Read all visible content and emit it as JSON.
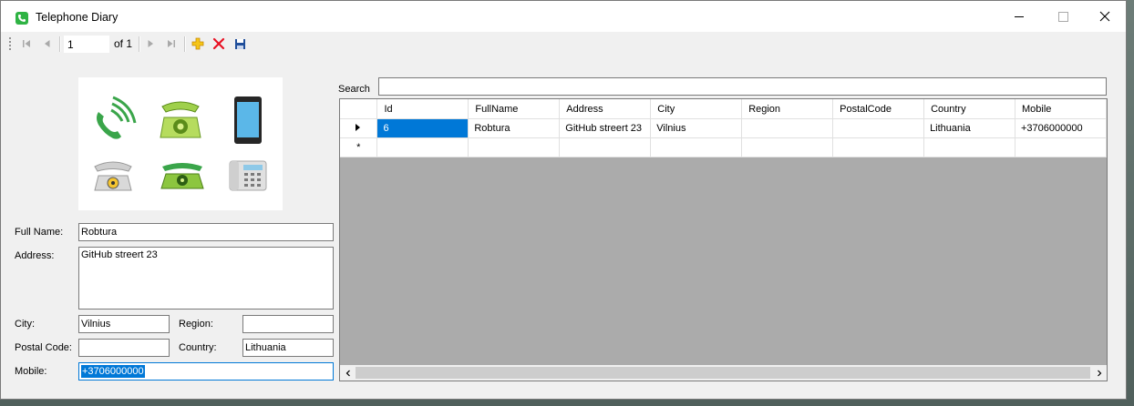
{
  "window": {
    "title": "Telephone Diary"
  },
  "navigator": {
    "position": "1",
    "count_label": "of 1"
  },
  "icons": {
    "app": "phone-icon",
    "first": "move-first-icon",
    "previous": "move-previous-icon",
    "next": "move-next-icon",
    "last": "move-last-icon",
    "add": "add-icon",
    "delete": "delete-icon",
    "save": "save-icon"
  },
  "colors": {
    "app_icon": "#2fb344",
    "add": "#e0a800",
    "delete": "#e81123",
    "save": "#1f4e9a",
    "selection": "#0078d7"
  },
  "form": {
    "full_name": {
      "label": "Full Name:",
      "value": "Robtura"
    },
    "address": {
      "label": "Address:",
      "value": "GitHub streert 23"
    },
    "city": {
      "label": "City:",
      "value": "Vilnius"
    },
    "region": {
      "label": "Region:",
      "value": ""
    },
    "postal_code": {
      "label": "Postal Code:",
      "value": ""
    },
    "country": {
      "label": "Country:",
      "value": "Lithuania"
    },
    "mobile": {
      "label": "Mobile:",
      "value": "+3706000000"
    }
  },
  "search": {
    "label": "Search",
    "value": ""
  },
  "grid": {
    "columns": [
      "Id",
      "FullName",
      "Address",
      "City",
      "Region",
      "PostalCode",
      "Country",
      "Mobile"
    ],
    "rows": [
      [
        "6",
        "Robtura",
        "GitHub streert 23",
        "Vilnius",
        "",
        "",
        "Lithuania",
        "+3706000000"
      ]
    ],
    "new_row_marker": "*"
  }
}
